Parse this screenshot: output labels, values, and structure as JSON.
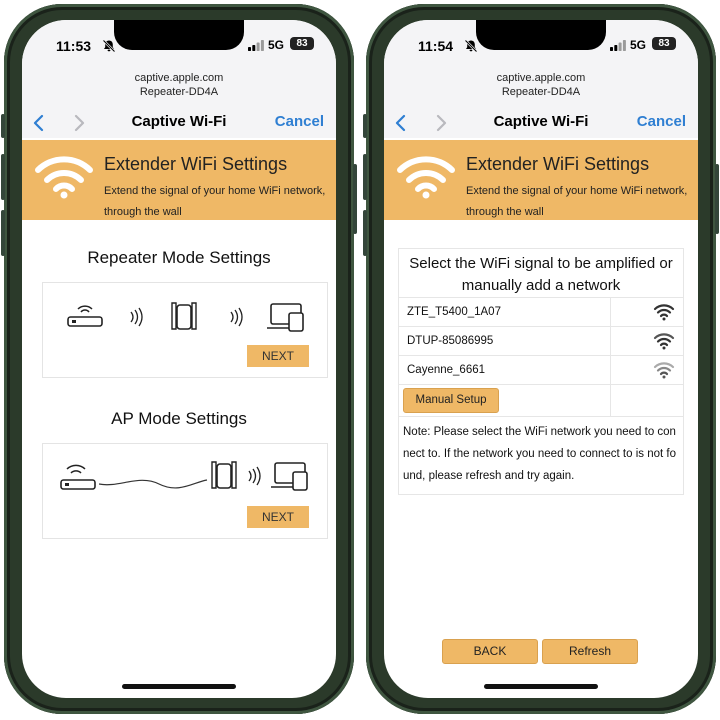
{
  "colors": {
    "accent": "#efb866",
    "link": "#2f7fd2",
    "frame": "#2b3a2a"
  },
  "left": {
    "status": {
      "time": "11:53",
      "network": "5G",
      "battery": "83"
    },
    "browser": {
      "domain": "captive.apple.com",
      "ssid": "Repeater-DD4A",
      "title": "Captive Wi-Fi",
      "cancel": "Cancel"
    },
    "banner": {
      "title": "Extender WiFi Settings",
      "subtitle": "Extend the signal of your home WiFi network, through the wall"
    },
    "sections": [
      {
        "title": "Repeater Mode Settings",
        "button": "NEXT"
      },
      {
        "title": "AP Mode Settings",
        "button": "NEXT"
      }
    ]
  },
  "right": {
    "status": {
      "time": "11:54",
      "network": "5G",
      "battery": "83"
    },
    "browser": {
      "domain": "captive.apple.com",
      "ssid": "Repeater-DD4A",
      "title": "Captive Wi-Fi",
      "cancel": "Cancel"
    },
    "banner": {
      "title": "Extender WiFi Settings",
      "subtitle": "Extend the signal of your home WiFi network, through the wall"
    },
    "wifi_list": {
      "heading": "Select the WiFi signal to be amplified or manually add a network",
      "networks": [
        {
          "ssid": "ZTE_T5400_1A07",
          "signal_icon": "wifi-strong-icon"
        },
        {
          "ssid": "DTUP-85086995",
          "signal_icon": "wifi-strong-icon"
        },
        {
          "ssid": "Cayenne_6661",
          "signal_icon": "wifi-weak-icon"
        }
      ],
      "manual_setup": "Manual Setup",
      "note": "Note: Please select the WiFi network you need to connect to. If the network you need to connect to is not found, please refresh and try again."
    },
    "buttons": {
      "back": "BACK",
      "refresh": "Refresh"
    }
  }
}
